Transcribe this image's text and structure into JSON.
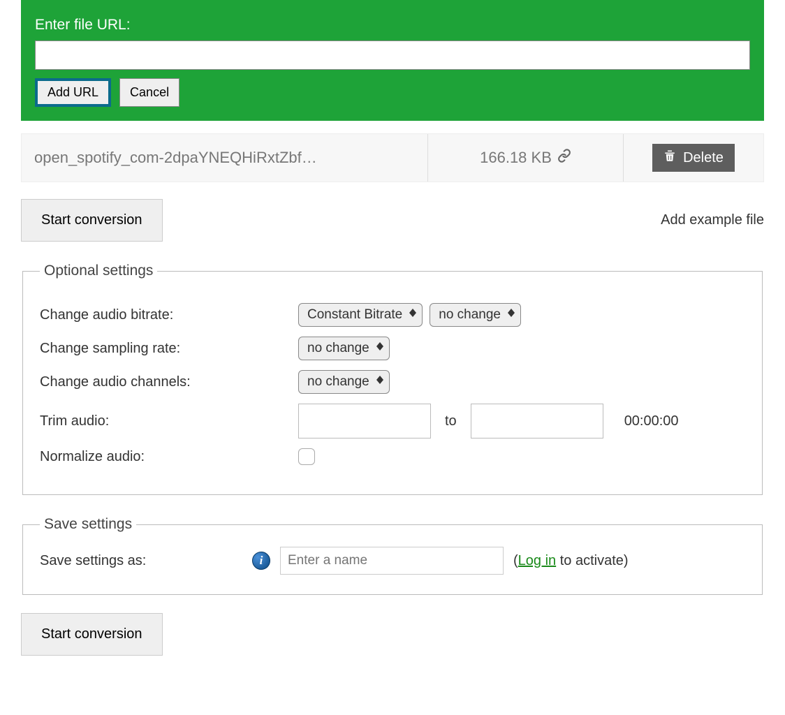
{
  "url_panel": {
    "label": "Enter file URL:",
    "value": "",
    "add_button": "Add URL",
    "cancel_button": "Cancel"
  },
  "file": {
    "name": "open_spotify_com-2dpaYNEQHiRxtZbf…",
    "size": "166.18 KB",
    "delete_label": "Delete"
  },
  "start_conversion": "Start conversion",
  "add_example": "Add example file",
  "optional": {
    "legend": "Optional settings",
    "bitrate_label": "Change audio bitrate:",
    "bitrate_mode": "Constant Bitrate",
    "bitrate_value": "no change",
    "sampling_label": "Change sampling rate:",
    "sampling_value": "no change",
    "channels_label": "Change audio channels:",
    "channels_value": "no change",
    "trim_label": "Trim audio:",
    "trim_from": "",
    "trim_to_text": "to",
    "trim_to": "",
    "trim_duration": "00:00:00",
    "normalize_label": "Normalize audio:"
  },
  "save": {
    "legend": "Save settings",
    "label": "Save settings as:",
    "placeholder": "Enter a name",
    "value": "",
    "hint_prefix": "(",
    "login_text": "Log in",
    "hint_suffix": " to activate)"
  }
}
